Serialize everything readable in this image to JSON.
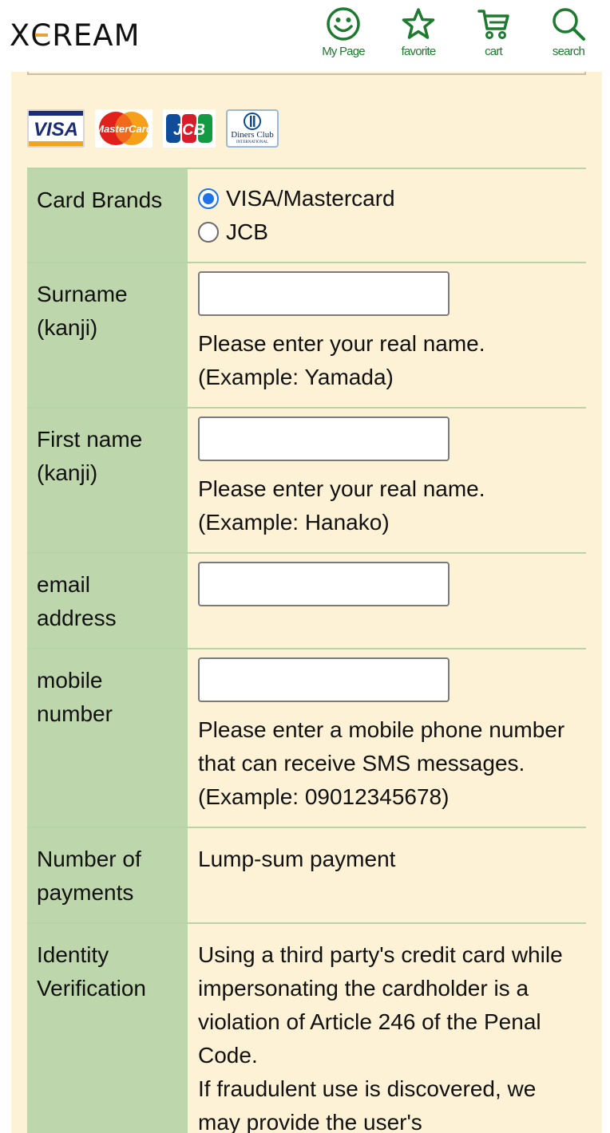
{
  "header": {
    "logo": "XCREAM",
    "nav": [
      {
        "label": "My Page",
        "icon": "smiley-icon"
      },
      {
        "label": "favorite",
        "icon": "star-icon"
      },
      {
        "label": "cart",
        "icon": "cart-icon"
      },
      {
        "label": "search",
        "icon": "search-icon"
      }
    ]
  },
  "cards": {
    "visa": "VISA",
    "mastercard": "MasterCard",
    "jcb": "JCB",
    "diners": "Diners Club",
    "diners_sub": "INTERNATIONAL"
  },
  "form": {
    "card_brands": {
      "label": "Card Brands",
      "options": [
        "VISA/Mastercard",
        "JCB"
      ],
      "selected": "VISA/Mastercard"
    },
    "surname": {
      "label_1": "Surname",
      "label_2": "(kanji)",
      "value": "",
      "note_1": "Please enter your real name.",
      "note_2": "(Example: Yamada)"
    },
    "first_name": {
      "label_1": "First name",
      "label_2": "(kanji)",
      "value": "",
      "note_1": "Please enter your real name.",
      "note_2": "(Example: Hanako)"
    },
    "email": {
      "label_1": "email",
      "label_2": "address",
      "value": ""
    },
    "mobile": {
      "label_1": "mobile",
      "label_2": "number",
      "value": "",
      "note_1": "Please enter a mobile phone number that can receive SMS messages.",
      "note_2": "(Example: 09012345678)"
    },
    "payments": {
      "label_1": "Number of",
      "label_2": "payments",
      "value": "Lump-sum payment"
    },
    "identity": {
      "label_1": "Identity",
      "label_2": "Verification",
      "text_1": "Using a third party's credit card while impersonating the cardholder is a violation of Article 246 of the Penal Code.",
      "text_2": "If fraudulent use is discovered, we may provide the user's"
    }
  },
  "colors": {
    "brand_green": "#1d7a2f",
    "panel_bg": "#fdf2d6",
    "label_bg": "#bdd6ab",
    "logo_accent": "#e9a23b",
    "radio_blue": "#1f73e8"
  }
}
